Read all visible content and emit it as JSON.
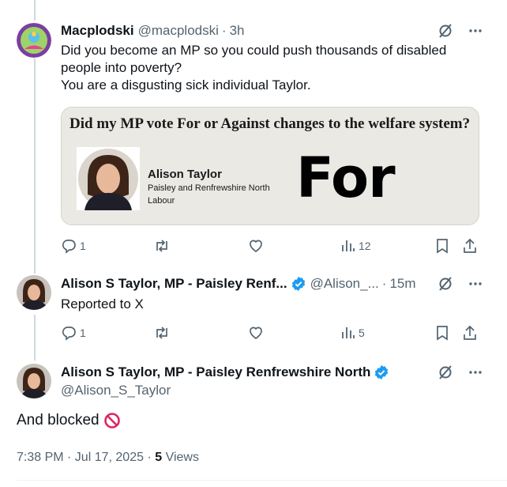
{
  "tweet1": {
    "name": "Macplodski",
    "handle": "@macplodski",
    "time": "3h",
    "text_lines": [
      "Did you become an MP so you could push thousands of disabled",
      "people into poverty?",
      "You are a disgusting sick individual Taylor."
    ],
    "card": {
      "heading": "Did my MP vote For or Against changes to the welfare system?",
      "mp_name": "Alison Taylor",
      "constituency": "Paisley and Renfrewshire North",
      "party": "Labour",
      "vote": "For"
    },
    "replies": "1",
    "views": "12"
  },
  "tweet2": {
    "name": "Alison S Taylor, MP - Paisley Renf...",
    "handle": "@Alison_...",
    "time": "15m",
    "text": "Reported to X",
    "replies": "1",
    "views": "5"
  },
  "tweet3": {
    "name": "Alison S Taylor, MP - Paisley Renfrewshire North",
    "handle": "@Alison_S_Taylor",
    "text": "And blocked",
    "timestamp": "7:38 PM · Jul 17, 2025",
    "views_count": "5",
    "views_label": "Views"
  },
  "colors": {
    "verified": "#1d9bf0",
    "muted": "#536471",
    "card_bg": "#ebe9e4"
  },
  "icons": [
    "grok-icon",
    "more-icon",
    "reply-icon",
    "retweet-icon",
    "like-icon",
    "views-icon",
    "bookmark-icon",
    "share-icon",
    "verified-badge-icon",
    "prohibited-icon"
  ]
}
